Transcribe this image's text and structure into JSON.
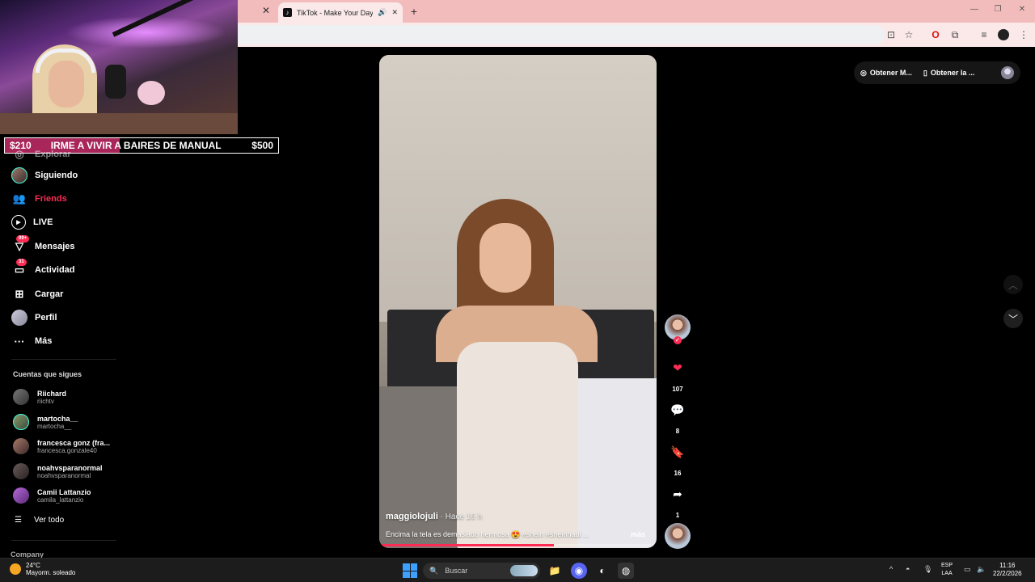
{
  "browser": {
    "tab_title": "TikTok - Make Your Day",
    "tab_close_prev": "✕",
    "tab_close": "✕",
    "new_tab": "+"
  },
  "stream": {
    "goal": {
      "current": "$210",
      "text": "IRME A VIVIR A BAIRES DE MANUAL",
      "target": "$500",
      "progress": 0.42
    }
  },
  "sidebar": {
    "partial_item": "Explorar",
    "items": [
      {
        "label": "Siguiendo",
        "icon": "following-avatar-icon"
      },
      {
        "label": "Friends",
        "icon": "friends-icon",
        "active": true
      },
      {
        "label": "LIVE",
        "icon": "live-icon"
      },
      {
        "label": "Mensajes",
        "icon": "messages-icon",
        "badge": "99+"
      },
      {
        "label": "Actividad",
        "icon": "activity-icon",
        "badge": "31"
      },
      {
        "label": "Cargar",
        "icon": "upload-icon"
      },
      {
        "label": "Perfil",
        "icon": "profile-icon"
      },
      {
        "label": "Más",
        "icon": "more-icon"
      }
    ],
    "following_title": "Cuentas que sigues",
    "following": [
      {
        "name": "Riichard",
        "user": "riichtv"
      },
      {
        "name": "martocha__",
        "user": "martocha__"
      },
      {
        "name": "francesca gonz (fra...",
        "user": "francesca.gonzale40"
      },
      {
        "name": "noahvsparanormal",
        "user": "noahvsparanormal"
      },
      {
        "name": "Camii Lattanzio",
        "user": "camila_lattanzio"
      }
    ],
    "see_all": "Ver todo",
    "company": "Company"
  },
  "video": {
    "username": "maggiolojuli",
    "time": " · Hace 16 h",
    "caption": "Encima la tela es demasiado hermosa 😍 #shein #sheinhaul ...",
    "more": "más",
    "progress": 0.63
  },
  "actions": {
    "likes": "107",
    "comments": "8",
    "saves": "16",
    "shares": "1"
  },
  "top_pill": {
    "item1": "Obtener M...",
    "item2": "Obtener la ..."
  },
  "taskbar": {
    "temp": "24°C",
    "weather": "Mayorm. soleado",
    "search": "Buscar",
    "lang1": "ESP",
    "lang2": "LAA",
    "time": "11:16",
    "date": "22/2/2026"
  },
  "colors": {
    "accent": "#fe2c55",
    "tabbar": "#f3bcbc",
    "goal_bar": "#a9265b"
  }
}
